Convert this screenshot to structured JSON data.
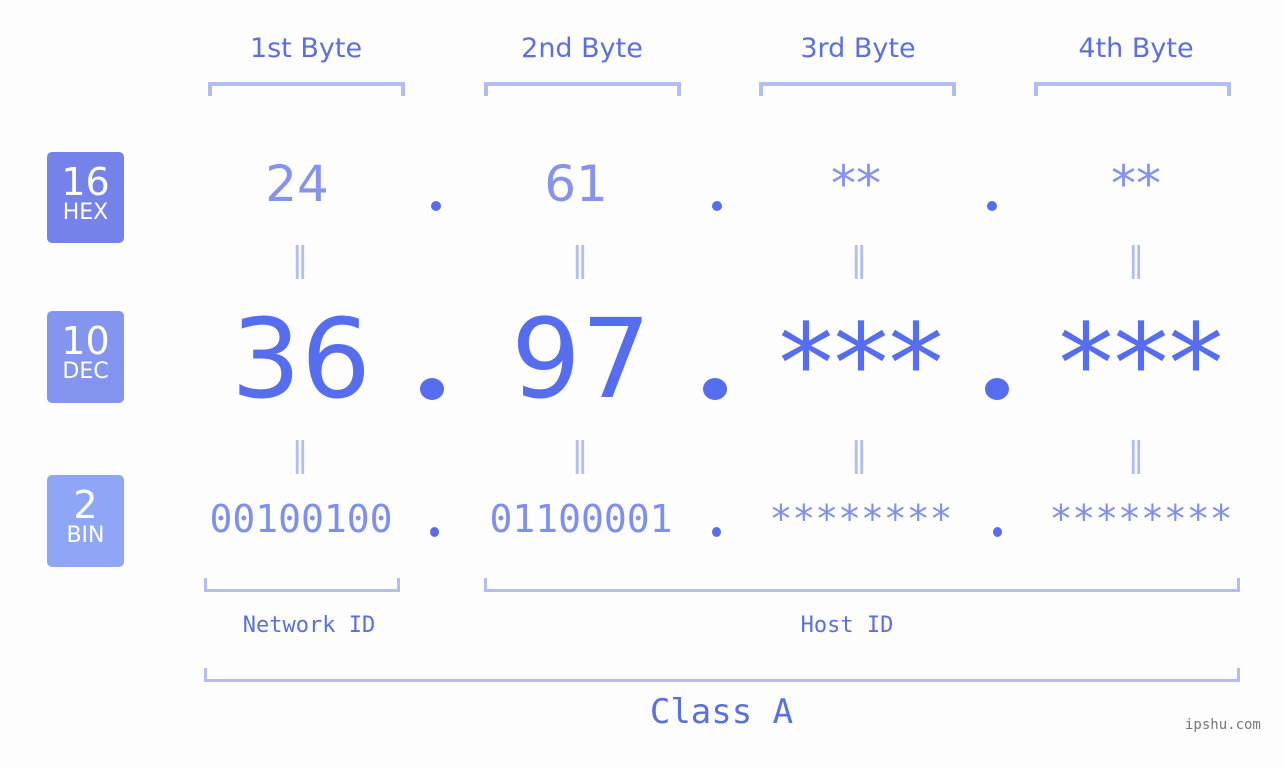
{
  "headers": [
    "1st Byte",
    "2nd Byte",
    "3rd Byte",
    "4th Byte"
  ],
  "badges": {
    "hex": {
      "number": "16",
      "label": "HEX"
    },
    "dec": {
      "number": "10",
      "label": "DEC"
    },
    "bin": {
      "number": "2",
      "label": "BIN"
    }
  },
  "hex_values": [
    "24",
    "61",
    "**",
    "**"
  ],
  "dec_values": [
    "36",
    "97",
    "***",
    "***"
  ],
  "bin_values": [
    "00100100",
    "01100001",
    "********",
    "********"
  ],
  "equals_sign": "=",
  "network_label": "Network ID",
  "host_label": "Host ID",
  "class_label": "Class A",
  "watermark": "ipshu.com",
  "colors": {
    "accent": "#566ded",
    "bracket": "#b3bdf5",
    "hex_badge": "#7482ea",
    "dec_badge": "#8495f0",
    "bin_badge": "#8fa6f7"
  }
}
